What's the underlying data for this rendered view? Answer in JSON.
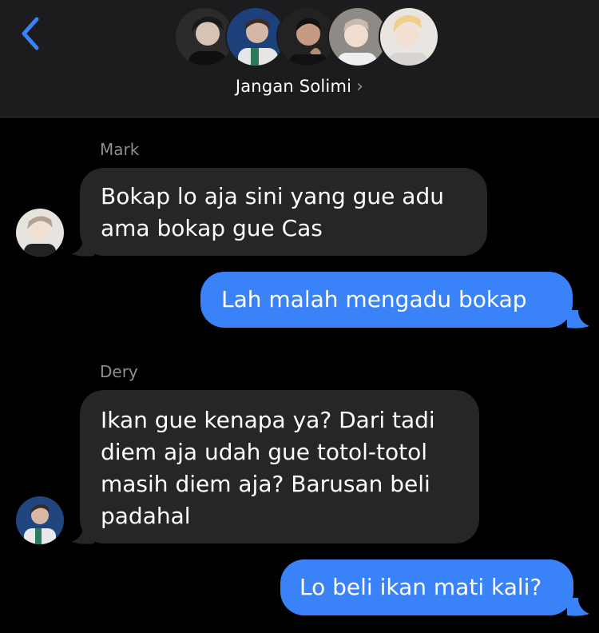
{
  "header": {
    "group_name": "Jangan Solimi",
    "chevron": "›",
    "back_icon": "chevron-left-icon",
    "accent": "#3a82f7"
  },
  "messages": [
    {
      "sender": "Mark",
      "direction": "incoming",
      "lines": [
        "Bokap lo aja sini yang gue adu",
        "ama bokap gue Cas"
      ]
    },
    {
      "direction": "outgoing",
      "lines": [
        "Lah malah mengadu bokap"
      ]
    },
    {
      "sender": "Dery",
      "direction": "incoming",
      "lines": [
        "Ikan gue kenapa ya? Dari tadi",
        "diem aja udah gue totol-totol",
        "masih diem aja? Barusan beli",
        "padahal"
      ]
    },
    {
      "direction": "outgoing",
      "lines": [
        "Lo beli ikan mati kali?"
      ]
    }
  ],
  "colors": {
    "background": "#000000",
    "header": "#1c1c1e",
    "incoming_bubble": "#262628",
    "outgoing_bubble": "#3a82f7",
    "sender_text": "#8e8e93"
  }
}
